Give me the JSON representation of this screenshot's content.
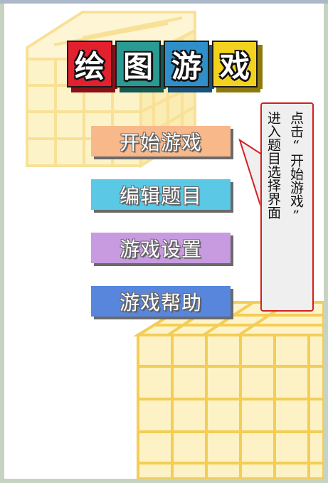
{
  "app": {
    "title_chars": [
      "绘",
      "图",
      "游",
      "戏"
    ]
  },
  "menu": {
    "items": [
      {
        "label": "开始游戏",
        "color": "#f8b88a"
      },
      {
        "label": "编辑题目",
        "color": "#5bc8e6"
      },
      {
        "label": "游戏设置",
        "color": "#c89ae0"
      },
      {
        "label": "游戏帮助",
        "color": "#5886dc"
      }
    ]
  },
  "hint": {
    "line1": "点击“开始游戏”",
    "line2": "进入题目选择界面"
  },
  "colors": {
    "tile_red": "#e2202e",
    "tile_teal": "#2a9a92",
    "tile_blue": "#2f8fc8",
    "tile_yellow": "#f2d21e",
    "cube_yellow": "#f6d36a",
    "hint_border": "#d22020"
  }
}
